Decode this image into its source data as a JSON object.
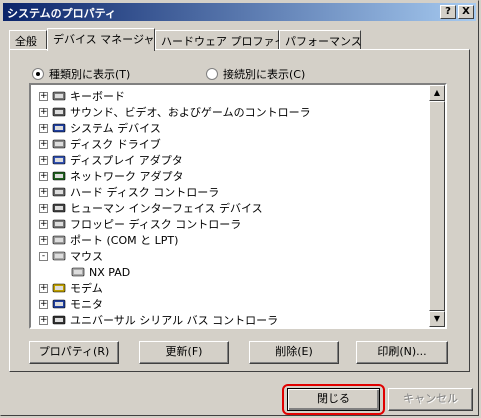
{
  "window": {
    "title": "システムのプロパティ",
    "help_glyph": "?",
    "close_glyph": "X"
  },
  "tabs": [
    {
      "label": "全般"
    },
    {
      "label": "デバイス マネージャ"
    },
    {
      "label": "ハードウェア プロファイル"
    },
    {
      "label": "パフォーマンス"
    }
  ],
  "view_options": {
    "by_type_label": "種類別に表示(T)",
    "by_connection_label": "接続別に表示(C)",
    "selected": "by_type"
  },
  "tree": {
    "items": [
      {
        "label": "キーボード",
        "expander": "+",
        "icon": "keyboard-icon"
      },
      {
        "label": "サウンド、ビデオ、およびゲームのコントローラ",
        "expander": "+",
        "icon": "sound-icon"
      },
      {
        "label": "システム デバイス",
        "expander": "+",
        "icon": "system-device-icon"
      },
      {
        "label": "ディスク ドライブ",
        "expander": "+",
        "icon": "disk-drive-icon"
      },
      {
        "label": "ディスプレイ アダプタ",
        "expander": "+",
        "icon": "display-adapter-icon"
      },
      {
        "label": "ネットワーク アダプタ",
        "expander": "+",
        "icon": "network-adapter-icon"
      },
      {
        "label": "ハード ディスク コントローラ",
        "expander": "+",
        "icon": "hdd-controller-icon"
      },
      {
        "label": "ヒューマン インターフェイス デバイス",
        "expander": "+",
        "icon": "hid-icon"
      },
      {
        "label": "フロッピー ディスク コントローラ",
        "expander": "+",
        "icon": "floppy-controller-icon"
      },
      {
        "label": "ポート (COM と LPT)",
        "expander": "+",
        "icon": "port-icon"
      },
      {
        "label": "マウス",
        "expander": "-",
        "icon": "mouse-icon"
      },
      {
        "label": "NX PAD",
        "expander": "",
        "icon": "mouse-icon",
        "child": true
      },
      {
        "label": "モデム",
        "expander": "+",
        "icon": "modem-icon"
      },
      {
        "label": "モニタ",
        "expander": "+",
        "icon": "monitor-icon"
      },
      {
        "label": "ユニバーサル シリアル バス コントローラ",
        "expander": "+",
        "icon": "usb-icon"
      }
    ]
  },
  "scrollbar": {
    "up_glyph": "▲",
    "down_glyph": "▼"
  },
  "actions": {
    "properties_label": "プロパティ(R)",
    "refresh_label": "更新(F)",
    "remove_label": "削除(E)",
    "print_label": "印刷(N)..."
  },
  "footer": {
    "close_label": "閉じる",
    "cancel_label": "キャンセル"
  },
  "colors": {
    "title_start": "#0a246a",
    "title_end": "#a6caf0",
    "highlight_ring": "#e00000",
    "face": "#d4d0c8"
  }
}
